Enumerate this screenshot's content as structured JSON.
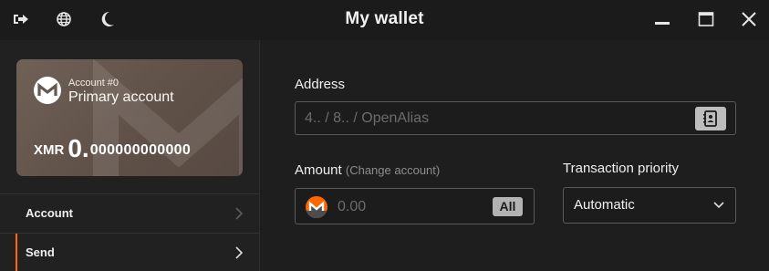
{
  "window": {
    "title": "My wallet"
  },
  "titlebar": {
    "left_icons": [
      "logout-icon",
      "globe-icon",
      "moon-icon"
    ],
    "right_icons": [
      "minimize-icon",
      "maximize-icon",
      "close-icon"
    ]
  },
  "account_card": {
    "account_number": "Account #0",
    "account_name": "Primary account",
    "currency": "XMR",
    "balance_integer": "0.",
    "balance_decimal": "000000000000"
  },
  "nav": {
    "items": [
      {
        "label": "Account",
        "active": false
      },
      {
        "label": "Send",
        "active": true
      }
    ]
  },
  "send_form": {
    "address": {
      "label": "Address",
      "placeholder": "4.. / 8.. / OpenAlias",
      "button_icon": "address-book-icon"
    },
    "amount": {
      "label": "Amount",
      "hint": "(Change account)",
      "placeholder": "0.00",
      "all_button": "All"
    },
    "priority": {
      "label": "Transaction priority",
      "value": "Automatic"
    }
  },
  "colors": {
    "accent": "#ff6600",
    "card_brown": "#655850",
    "background": "#1e1e1e"
  }
}
